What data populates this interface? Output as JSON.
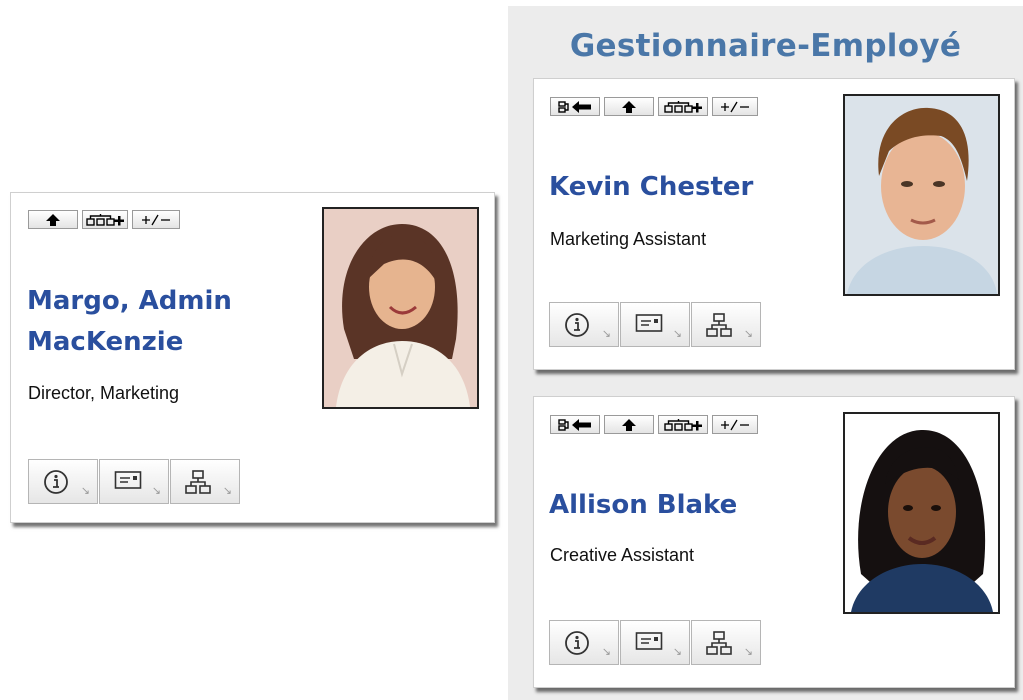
{
  "panel": {
    "title": "Gestionnaire-Employé"
  },
  "manager": {
    "name": "Margo, Admin MacKenzie",
    "title": "Director, Marketing",
    "toolbar": [
      "move-up",
      "show-reports",
      "expand-collapse"
    ],
    "photo": "woman-brown-hair-portrait"
  },
  "employees": [
    {
      "name": "Kevin Chester",
      "title": "Marketing Assistant",
      "toolbar": [
        "back-to-manager",
        "move-up",
        "show-reports",
        "expand-collapse"
      ],
      "photo": "man-brown-hair-portrait"
    },
    {
      "name": "Allison Blake",
      "title": "Creative Assistant",
      "toolbar": [
        "back-to-manager",
        "move-up",
        "show-reports",
        "expand-collapse"
      ],
      "photo": "woman-black-hair-portrait"
    }
  ],
  "actions": {
    "info": "info-icon",
    "email": "email-card-icon",
    "org_chart": "org-chart-icon",
    "corner_glyph": "↘"
  },
  "colors": {
    "name_text": "#2a4f9e",
    "panel_title": "#4a77a8",
    "panel_bg": "#ececec"
  }
}
